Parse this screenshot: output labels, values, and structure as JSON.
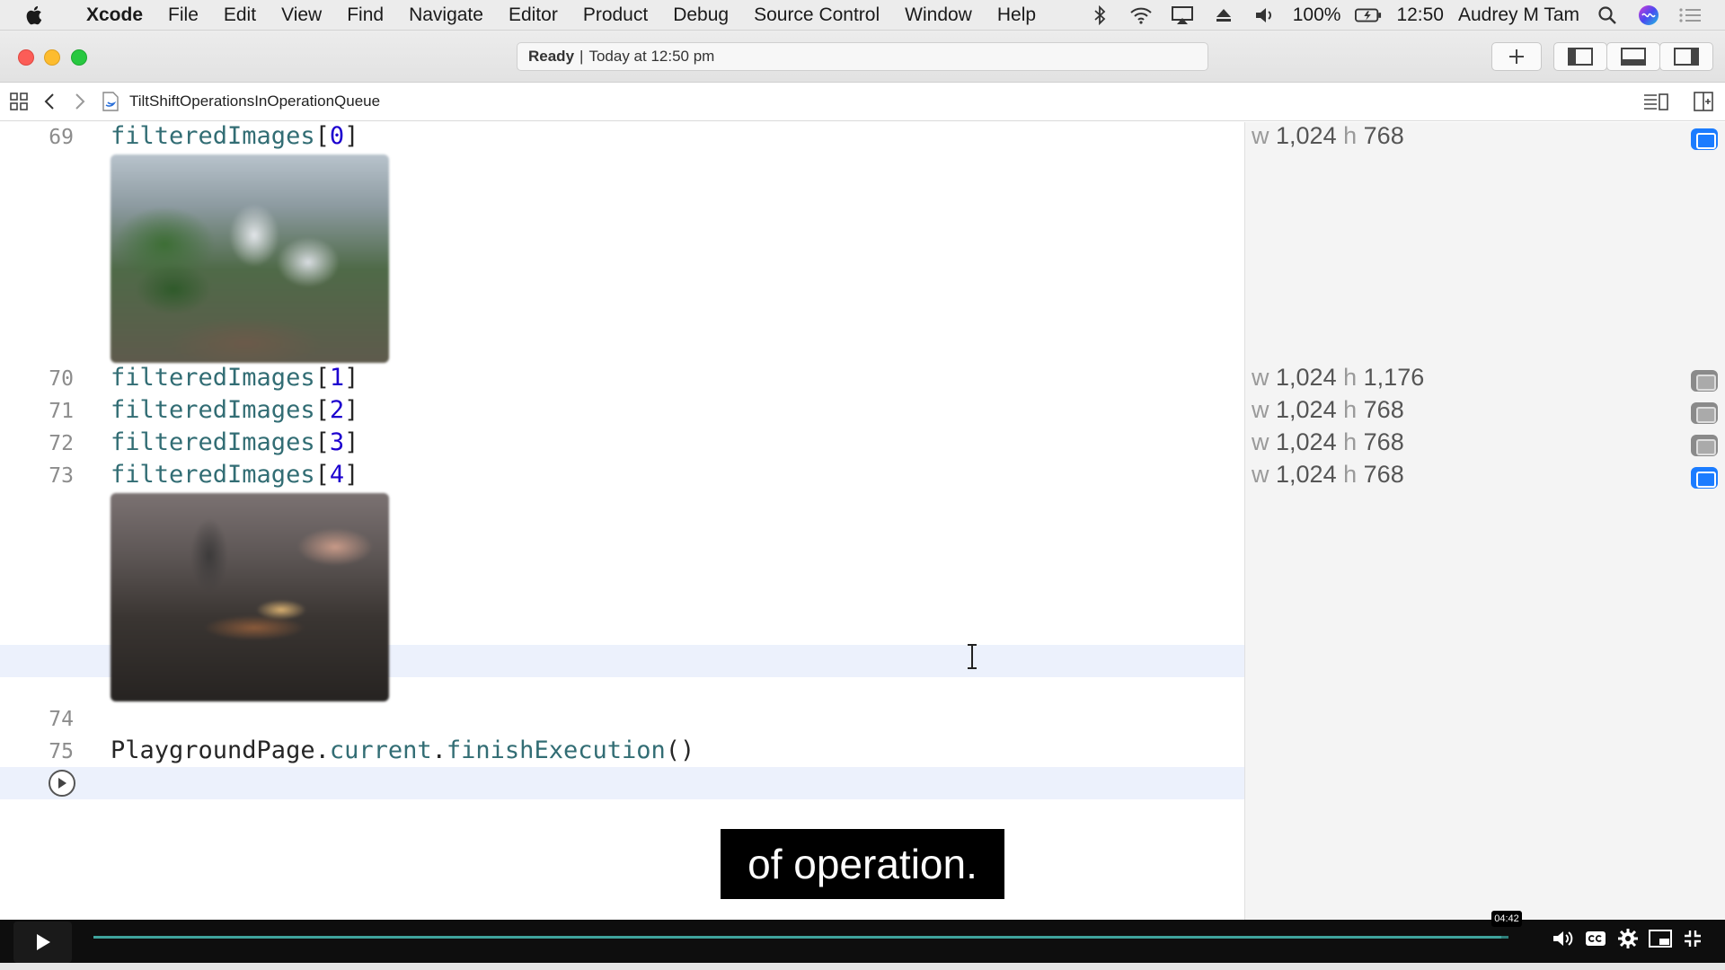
{
  "menubar": {
    "app_name": "Xcode",
    "items": [
      "File",
      "Edit",
      "View",
      "Find",
      "Navigate",
      "Editor",
      "Product",
      "Debug",
      "Source Control",
      "Window",
      "Help"
    ],
    "battery": "100%",
    "time": "12:50",
    "user": "Audrey M Tam"
  },
  "toolbar": {
    "status_bold": "Ready",
    "status_sep": "|",
    "status_text": "Today at 12:50 pm"
  },
  "jumpbar": {
    "file_name": "TiltShiftOperationsInOperationQueue"
  },
  "editor": {
    "lines": [
      {
        "number": "69",
        "ident": "filteredImages",
        "open": "[",
        "index": "0",
        "close": "]"
      },
      {
        "number": "70",
        "ident": "filteredImages",
        "open": "[",
        "index": "1",
        "close": "]"
      },
      {
        "number": "71",
        "ident": "filteredImages",
        "open": "[",
        "index": "2",
        "close": "]"
      },
      {
        "number": "72",
        "ident": "filteredImages",
        "open": "[",
        "index": "3",
        "close": "]"
      },
      {
        "number": "73",
        "ident": "filteredImages",
        "open": "[",
        "index": "4",
        "close": "]"
      }
    ],
    "line74": {
      "number": "74"
    },
    "line75": {
      "number": "75",
      "obj": "PlaygroundPage",
      "dot1": ".",
      "prop": "current",
      "dot2": ".",
      "method": "finishExecution",
      "parens": "()"
    }
  },
  "results": [
    {
      "w_label": "w",
      "w": "1,024",
      "h_label": "h",
      "h": "768",
      "toggle": "on"
    },
    {
      "w_label": "w",
      "w": "1,024",
      "h_label": "h",
      "h": "1,176",
      "toggle": "off"
    },
    {
      "w_label": "w",
      "w": "1,024",
      "h_label": "h",
      "h": "768",
      "toggle": "off"
    },
    {
      "w_label": "w",
      "w": "1,024",
      "h_label": "h",
      "h": "768",
      "toggle": "off"
    },
    {
      "w_label": "w",
      "w": "1,024",
      "h_label": "h",
      "h": "768",
      "toggle": "on"
    }
  ],
  "caption": "of operation.",
  "video": {
    "time": "04:42",
    "progress": 0.995
  }
}
